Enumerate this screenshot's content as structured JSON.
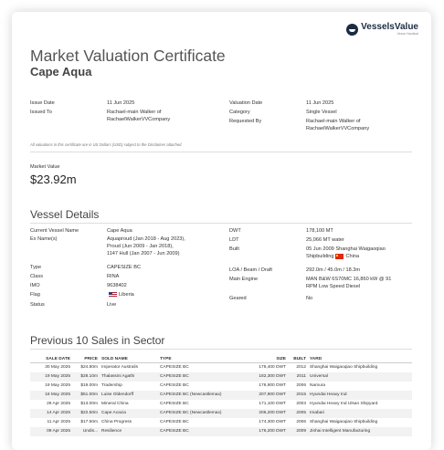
{
  "brand": {
    "name": "VesselsValue",
    "tagline": "Veson Nautical"
  },
  "certificate": {
    "title": "Market Valuation Certificate",
    "vessel_name": "Cape Aqua"
  },
  "issue": {
    "issue_date_label": "Issue Date",
    "issue_date": "11 Jun 2025",
    "issued_to_label": "Issued To",
    "issued_to": [
      "Rachael-main Walker of",
      "RachaelWalkerVVCompany"
    ],
    "valuation_date_label": "Valuation Date",
    "valuation_date": "11 Jun 2025",
    "category_label": "Category",
    "category": "Single Vessel",
    "requested_by_label": "Requested By",
    "requested_by": [
      "Rachael-main Walker of",
      "RachaelWalkerVVCompany"
    ]
  },
  "note": "All valuations in this certificate are in US Dollars (USD) subject to the Disclaimer attached.",
  "market_value": {
    "label": "Market Value",
    "value": "$23.92m"
  },
  "vessel_details": {
    "heading": "Vessel Details",
    "left": [
      {
        "label": "Current Vessel Name",
        "value": [
          "Cape Aqua"
        ]
      },
      {
        "label": "Ex Name(s)",
        "value": [
          "Aquaproud (Jan 2018 - Aug 2023),",
          "Proud (Jun 2009 - Jan 2018),",
          "1147 Hull (Jan 2007 - Jun 2009)"
        ]
      },
      {
        "label": "Type",
        "value": [
          "CAPESIZE BC"
        ]
      },
      {
        "label": "Class",
        "value": [
          "RINA"
        ]
      },
      {
        "label": "IMO",
        "value": [
          "9638402"
        ]
      },
      {
        "label": "Flag",
        "value": [
          "Liberia"
        ]
      },
      {
        "label": "Status",
        "value": [
          "Live"
        ]
      }
    ],
    "right": [
      {
        "label": "DWT",
        "value": [
          "178,100 MT"
        ]
      },
      {
        "label": "LDT",
        "value": [
          "25,066 MT water"
        ]
      },
      {
        "label": "Built",
        "value": [
          "05 Jun 2009 Shanghai Waigaoqiao",
          "Shipbuilding",
          "China"
        ]
      },
      {
        "label": "LOA / Beam / Draft",
        "value": [
          "292.0m / 45.0m / 18.3m"
        ]
      },
      {
        "label": "Main Engine",
        "value": [
          "MAN B&W 6S70MC 16,860 kW @ 91",
          "RPM Low Speed Diesel"
        ]
      },
      {
        "label": "Geared",
        "value": [
          "No"
        ]
      }
    ]
  },
  "sales": {
    "heading": "Previous 10 Sales in Sector",
    "columns": [
      "SALE DATE",
      "PRICE",
      "SOLD NAME",
      "TYPE",
      "SIZE",
      "BUILT",
      "YARD"
    ],
    "rows": [
      [
        "30 May 2025",
        "$24.80m",
        "Imperator Australis",
        "CAPESIZE BC",
        "176,400 DWT",
        "2012",
        "Shanghai Waigaoqiao Shipbuilding"
      ],
      [
        "19 May 2025",
        "$28.10m",
        "Thalassini Agathi",
        "CAPESIZE BC",
        "182,300 DWT",
        "2011",
        "Universal"
      ],
      [
        "19 May 2025",
        "$19.00m",
        "Tradership",
        "CAPESIZE BC",
        "176,900 DWT",
        "2006",
        "Namura"
      ],
      [
        "16 May 2025",
        "$51.00m",
        "Luise Oldendorff",
        "CAPESIZE BC (Newcastlemax)",
        "207,800 DWT",
        "2015",
        "Hyundai Heavy Ind"
      ],
      [
        "29 Apr 2025",
        "$13.00m",
        "Mineral China",
        "CAPESIZE BC",
        "171,100 DWT",
        "2003",
        "Hyundai Heavy Ind Ulsan Shipyard"
      ],
      [
        "14 Apr 2025",
        "$22.50m",
        "Cape Acacia",
        "CAPESIZE BC (Newcastlemax)",
        "206,200 DWT",
        "2005",
        "Imabari"
      ],
      [
        "11 Apr 2025",
        "$17.50m",
        "China Progress",
        "CAPESIZE BC",
        "174,300 DWT",
        "2006",
        "Shanghai Waigaoqiao Shipbuilding"
      ],
      [
        "09 Apr 2025",
        "Undis...",
        "Resilience",
        "CAPESIZE BC",
        "176,200 DWT",
        "2009",
        "Jinhai Intelligent Manufacturing"
      ]
    ]
  }
}
